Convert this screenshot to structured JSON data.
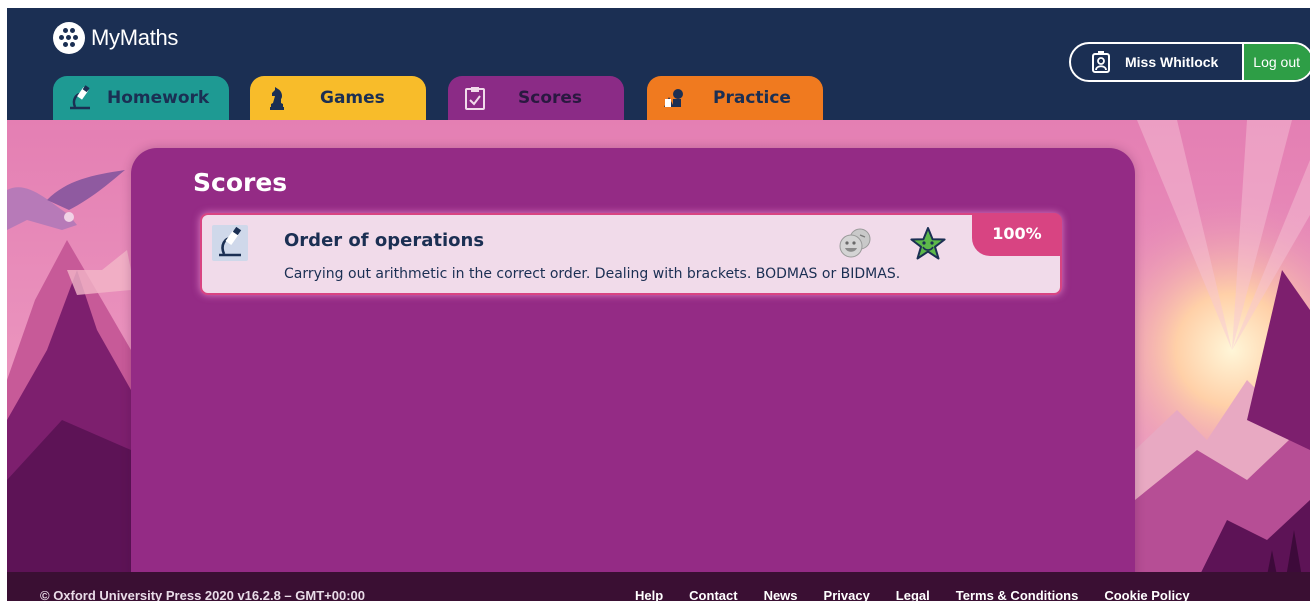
{
  "header": {
    "brand": "MyMaths",
    "tabs": [
      {
        "label": "Homework",
        "icon": "microscope-icon",
        "color": "#1e9a93"
      },
      {
        "label": "Games",
        "icon": "chess-knight-icon",
        "color": "#f8bc2a"
      },
      {
        "label": "Scores",
        "icon": "clipboard-check-icon",
        "color": "#8b2b86",
        "active": true
      },
      {
        "label": "Practice",
        "icon": "shapes-icon",
        "color": "#f07a1f"
      }
    ],
    "user": {
      "name": "Miss Whitlock",
      "icon": "id-badge-icon"
    },
    "logout_label": "Log out"
  },
  "main": {
    "title": "Scores",
    "items": [
      {
        "title": "Order of operations",
        "description": "Carrying out arithmetic in the correct order. Dealing with brackets. BODMAS or BIDMAS.",
        "icon": "microscope-icon",
        "score": "100%",
        "badges": [
          "smiley-faces-icon",
          "green-star-icon"
        ]
      }
    ]
  },
  "footer": {
    "copyright": "© Oxford University Press 2020   v16.2.8 – GMT+00:00",
    "links": [
      "Help",
      "Contact",
      "News",
      "Privacy",
      "Legal",
      "Terms & Conditions",
      "Cookie Policy"
    ]
  },
  "colors": {
    "header_bg": "#1b2f53",
    "panel_bg": "#942b85",
    "card_bg": "#f1dbea",
    "accent_pink": "#d84482",
    "logout_green": "#2e9e46"
  }
}
